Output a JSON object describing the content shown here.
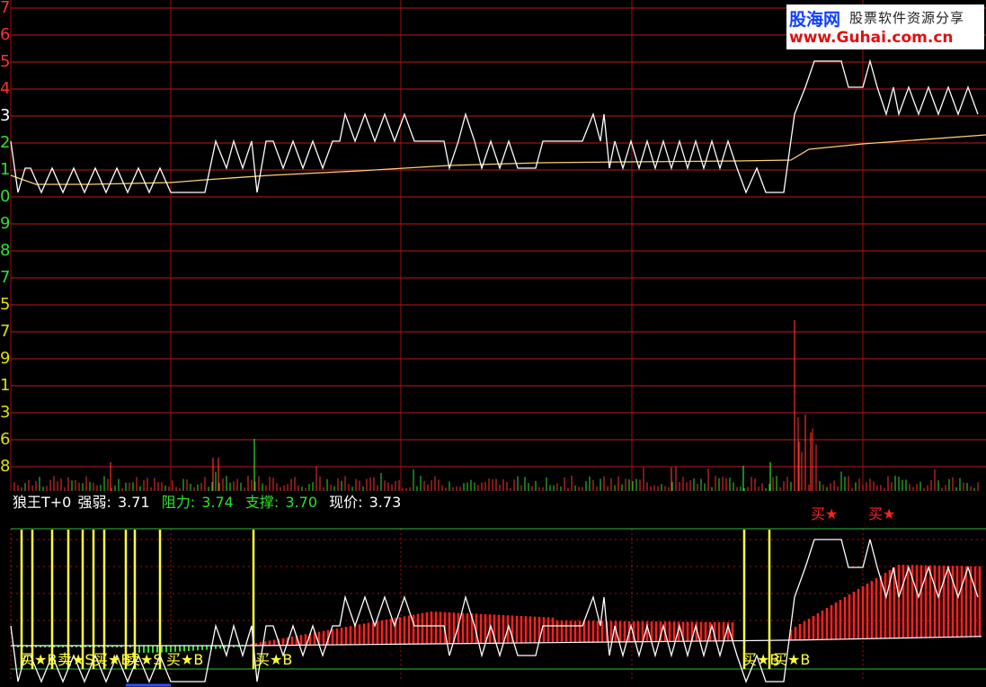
{
  "watermark": {
    "brand": "股海网",
    "slogan": "股票软件资源分享",
    "url": "www.Guhai.com.cn"
  },
  "y_axis_labels": [
    {
      "text": "7",
      "color": "#ff3030"
    },
    {
      "text": "6",
      "color": "#ff3030"
    },
    {
      "text": "5",
      "color": "#ff3030"
    },
    {
      "text": "4",
      "color": "#ff3030"
    },
    {
      "text": "3",
      "color": "#ffffff"
    },
    {
      "text": "2",
      "color": "#30e030"
    },
    {
      "text": "1",
      "color": "#30e030"
    },
    {
      "text": "0",
      "color": "#30e030"
    },
    {
      "text": "9",
      "color": "#30e030"
    },
    {
      "text": "8",
      "color": "#30e030"
    },
    {
      "text": "7",
      "color": "#30e030"
    },
    {
      "text": "5",
      "color": "#e0e000"
    },
    {
      "text": "7",
      "color": "#e0e000"
    },
    {
      "text": "9",
      "color": "#e0e000"
    },
    {
      "text": "1",
      "color": "#e0e000"
    },
    {
      "text": "3",
      "color": "#e0e000"
    },
    {
      "text": "6",
      "color": "#e0e000"
    },
    {
      "text": "8",
      "color": "#e0e000"
    }
  ],
  "indicator": {
    "name": "狼王T+0",
    "strength_label": "强弱:",
    "strength_value": "3.71",
    "resistance_label": "阻力:",
    "resistance_value": "3.74",
    "support_label": "支撑:",
    "support_value": "3.70",
    "price_label": "现价:",
    "price_value": "3.73"
  },
  "signals": {
    "buy_b": "买★B",
    "sell_s": "卖★S",
    "buy_star": "买★"
  },
  "colors": {
    "background": "#000000",
    "price_grid": "#c01818",
    "time_grid": "#a01010",
    "indicator_grid": "#30c030",
    "price_line": "#ffffff",
    "avg_line": "#ffd070",
    "volume_up": "#ff3030",
    "volume_down": "#30e030",
    "signal_bar": "#ffff40",
    "red_bar": "#ff2020",
    "green_bar": "#30e030"
  }
}
